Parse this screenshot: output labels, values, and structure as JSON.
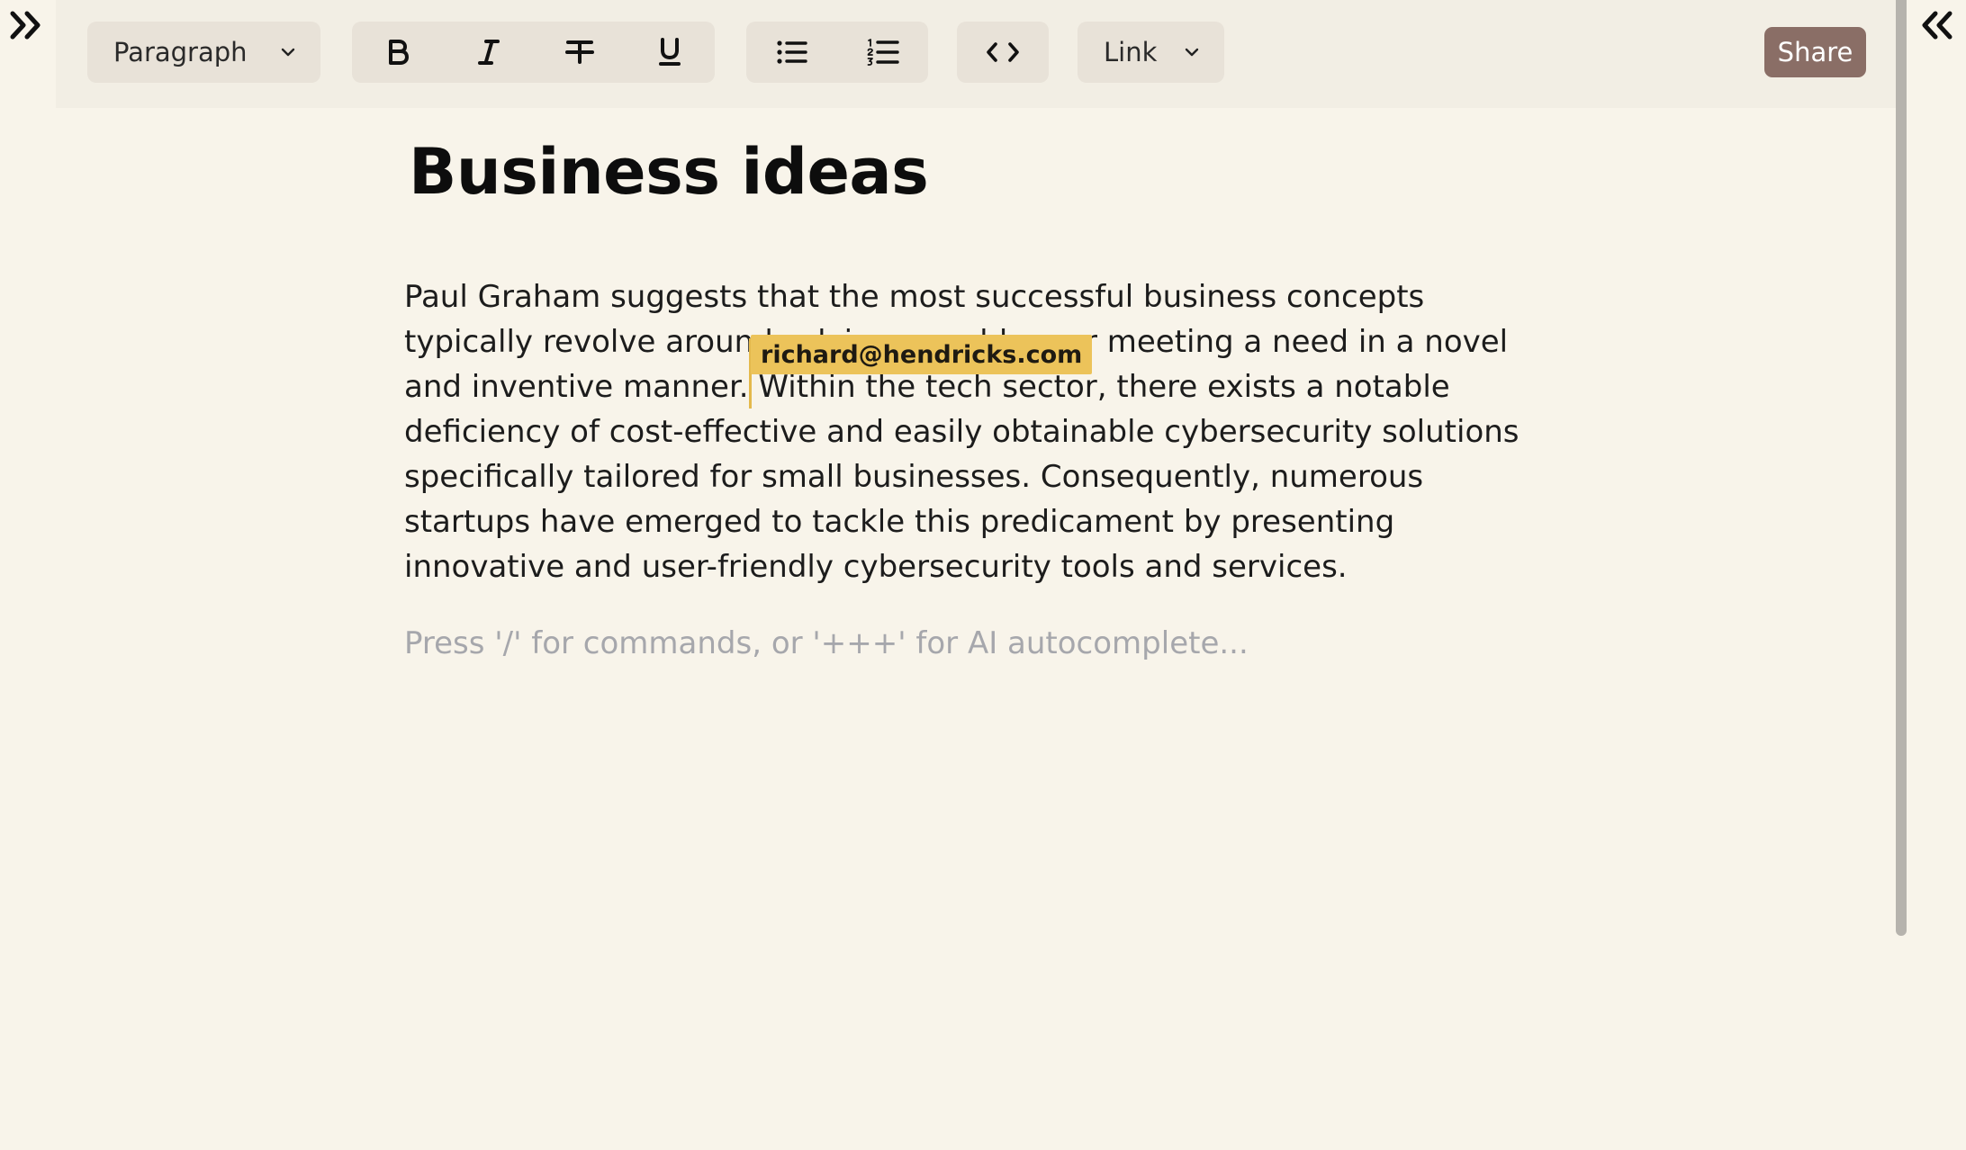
{
  "toolbar": {
    "block_type": "Paragraph",
    "link_label": "Link",
    "share_label": "Share"
  },
  "icons": {
    "left_toggle": "double-chevron-right-icon",
    "right_toggle": "double-chevron-left-icon",
    "bold": "bold-icon",
    "italic": "italic-icon",
    "strikethrough": "strikethrough-icon",
    "underline": "underline-icon",
    "bullet_list": "bullet-list-icon",
    "numbered_list": "numbered-list-icon",
    "code": "code-icon",
    "dropdown": "chevron-down-icon"
  },
  "document": {
    "title": "Business ideas",
    "paragraph": "Paul Graham suggests that the most successful business concepts typically revolve around solving a problem or meeting a need in a novel and inventive manner. Within the tech sector, there exists a notable deficiency of cost-effective and easily obtainable cybersecurity solutions specifically tailored for small businesses. Consequently, numerous startups have emerged to tackle this predicament by presenting innovative and user-friendly cybersecurity tools and services.",
    "placeholder": "Press '/' for commands, or '+++' for AI autocomplete..."
  },
  "collaborator": {
    "email": "richard@hendricks.com",
    "color": "#ecc35a"
  },
  "colors": {
    "background": "#f8f4ea",
    "toolbar": "#f2eee4",
    "button_group": "#e8e2d8",
    "share_button": "#8a6e66",
    "placeholder_text": "#a6a7ac"
  }
}
